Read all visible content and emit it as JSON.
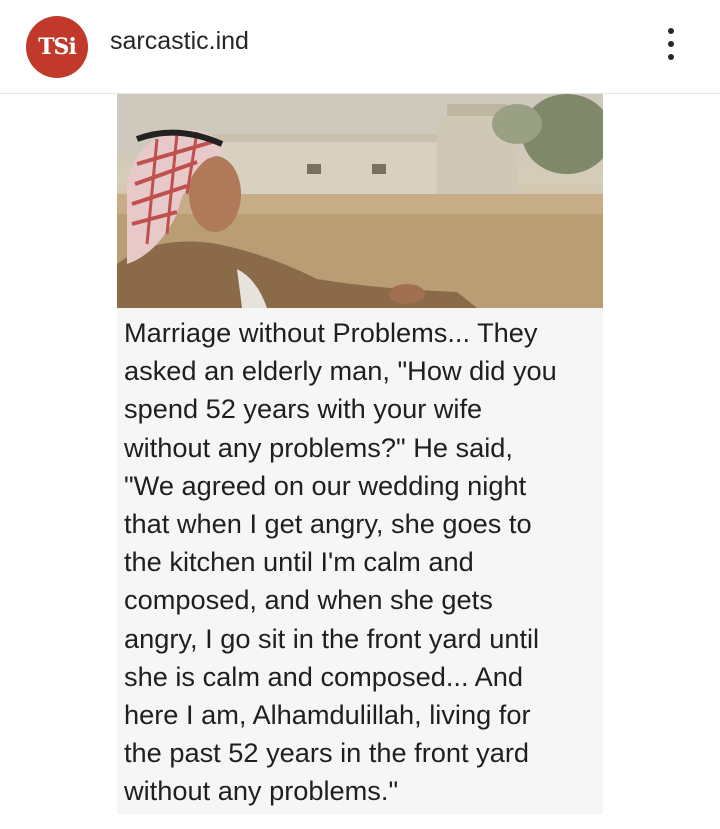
{
  "header": {
    "avatar_text": "TSi",
    "username": "sarcastic.ind"
  },
  "post": {
    "photo_alt": "Elderly man in red and white keffiyeh",
    "caption_lines": [
      "Marriage without Problems...  They",
      "asked an elderly man, \"How did you",
      "spend 52 years with your wife",
      "without any problems?\"  He said,",
      "\"We agreed on our wedding night",
      "that when I get angry, she goes to",
      "the kitchen until I'm calm and",
      "composed, and when she gets",
      "angry, I go sit in the front yard until",
      "she is calm and composed...  And",
      "here I am, Alhamdulillah, living for",
      "the past 52 years in the front yard",
      "without any problems.\""
    ]
  },
  "colors": {
    "avatar_bg": "#c0392b",
    "post_bg": "#f6f6f6",
    "text": "#262626"
  }
}
